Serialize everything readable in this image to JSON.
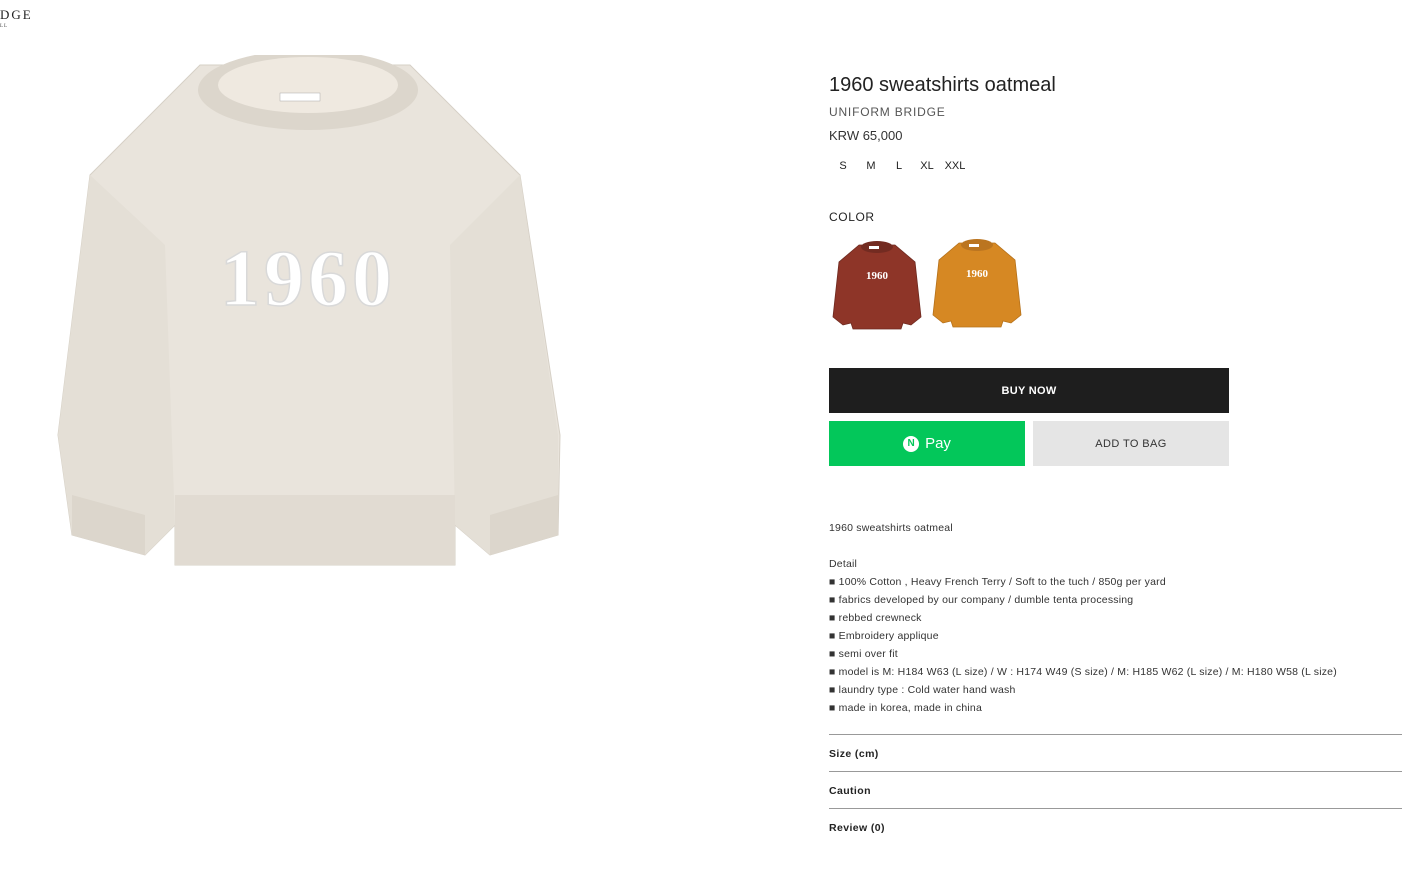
{
  "header": {
    "logo": "DGE",
    "logo_sub": "LL"
  },
  "product": {
    "image_icon": "oatmeal-sweatshirt-image",
    "graphic_text": "1960",
    "title": "1960 sweatshirts oatmeal",
    "brand": "UNIFORM BRIDGE",
    "price": "KRW 65,000",
    "sizes": [
      "S",
      "M",
      "L",
      "XL",
      "XXL"
    ],
    "color_label": "COLOR",
    "colors": [
      {
        "name": "brick",
        "hex": "#8e3528",
        "text": "1960"
      },
      {
        "name": "orange",
        "hex": "#d68823",
        "text": "1960"
      }
    ]
  },
  "actions": {
    "buy_now": "BUY NOW",
    "npay_badge": "N",
    "npay_label": "Pay",
    "add_to_bag": "ADD TO BAG",
    "npay_color": "#03c75a"
  },
  "description": {
    "intro": "1960 sweatshirts oatmeal",
    "detail_heading": "Detail",
    "bullets": [
      "■ 100% Cotton , Heavy French Terry / Soft to the tuch / 850g per yard",
      "■ fabrics developed by our company / dumble tenta processing",
      "■ rebbed crewneck",
      "■ Embroidery applique",
      "■ semi over fit",
      "■ model is M: H184 W63 (L size) / W : H174 W49 (S size) / M: H185 W62 (L size) / M: H180 W58 (L size)",
      "■ laundry type : Cold water hand wash",
      "■ made in korea, made in china"
    ]
  },
  "accordion": [
    "Size (cm)",
    "Caution",
    "Review (0)"
  ]
}
